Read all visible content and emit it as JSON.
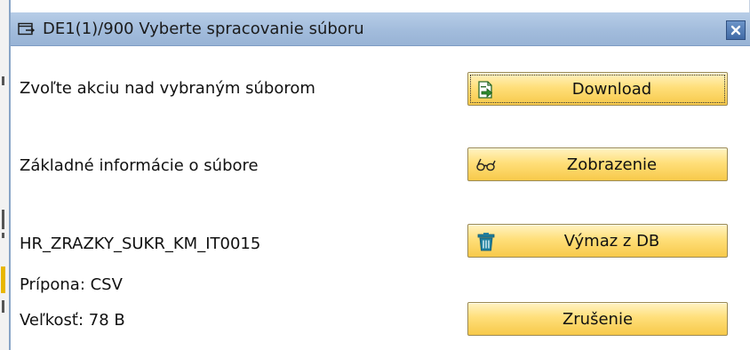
{
  "dialog": {
    "title": "DE1(1)/900 Vyberte spracovanie súboru",
    "title_icon": "window-icon",
    "close_icon": "close-icon"
  },
  "actions": {
    "choose_label": "Zvoľte akciu nad vybraným súborom",
    "info_label": "Základné informácie o súbore"
  },
  "file": {
    "name": "HR_ZRAZKY_SUKR_KM_IT0015",
    "extension": "Prípona: CSV",
    "size": "Veľkosť: 78 B"
  },
  "buttons": {
    "download": {
      "label": "Download",
      "icon": "download-icon"
    },
    "display": {
      "label": "Zobrazenie",
      "icon": "glasses-icon"
    },
    "delete": {
      "label": "Výmaz z DB",
      "icon": "trash-icon"
    },
    "cancel": {
      "label": "Zrušenie"
    }
  },
  "colors": {
    "titlebar": "#a2bcdc",
    "button_fill": "#ffdf7a",
    "close_button": "#416aa6",
    "icon_green": "#2f8a2f",
    "icon_teal": "#1f7f9e"
  }
}
